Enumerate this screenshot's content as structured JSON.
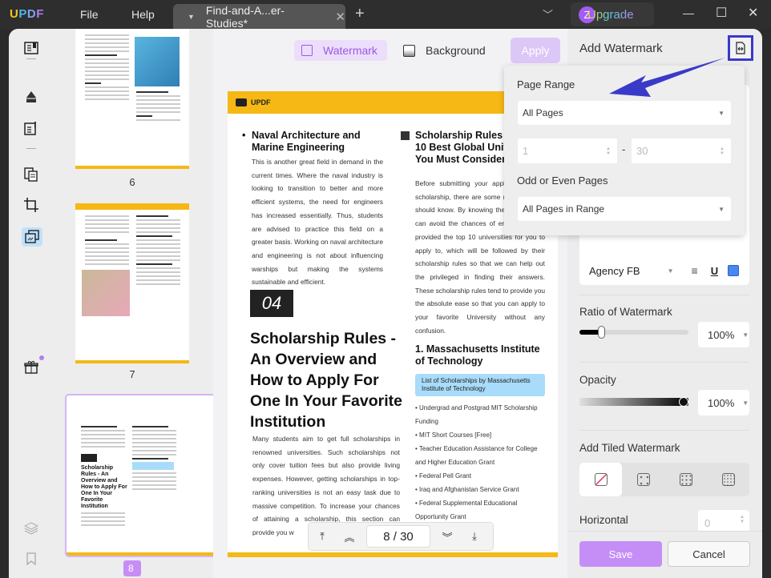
{
  "app": {
    "logo": [
      "U",
      "P",
      "D",
      "F"
    ],
    "menu": [
      "File",
      "Help"
    ]
  },
  "tab": {
    "title": "Find-and-A...er-Studies*",
    "close": "✕",
    "new_tab": "+"
  },
  "account": {
    "avatar_letter": "Z",
    "upgrade_label": "Upgrade"
  },
  "window": {
    "minimize": "—",
    "maximize": "☐",
    "close": "✕",
    "tab_list": "⌄"
  },
  "toolbar": {
    "watermark_label": "Watermark",
    "background_label": "Background",
    "apply_label": "Apply"
  },
  "thumbnails": [
    {
      "page": "6",
      "selected": false
    },
    {
      "page": "7",
      "selected": false
    },
    {
      "page": "8",
      "selected": true
    }
  ],
  "document": {
    "header_brand": "UPDF",
    "col1_heading": "Naval Architecture and Marine Engineering",
    "col1_body": "This is another great field in demand in the current times. Where the naval industry is looking to transition to better and more efficient systems, the need for engineers has increased essentially. Thus, students are advised to practice this field on a greater basis. Working on naval architecture and engineering is not about influencing warships but making the systems sustainable and efficient.",
    "section_number": "04",
    "section_title": "Scholarship Rules - An Overview and How to Apply For One In Your Favorite Institution",
    "section_body": "Many students aim to get full scholarships in renowned universities. Such scholarships not only cover tuition fees but also provide living expenses. However, getting scholarships in top-ranking universities is not an easy task due to massive competition. To increase your chances of attaining a scholarship, this section can provide you w",
    "col2_heading": "Scholarship Rules for the 10 Best Global Universities You Must Consider",
    "col2_body": "Before submitting your application for a scholarship, there are some rules that you should know. By knowing these rules, you can avoid the chances of error. We have provided the top 10 universities for you to apply to, which will be followed by their scholarship rules so that we can help out the privileged in finding their answers. These scholarship rules tend to provide you the absolute ease so that you can apply to your favorite University without any confusion.",
    "mit_heading": "1. Massachusetts Institute of Technology",
    "mit_box": "List of Scholarships by Massachusetts Institute of Technology",
    "mit_list": [
      "Undergrad and Postgrad MIT Scholarship Funding",
      "MIT Short Courses [Free]",
      "Teacher Education Assistance for College and Higher Education Grant",
      "Federal Pell Grant",
      "Iraq and Afghanistan Service Grant",
      "Federal Supplemental Educational Opportunity Grant"
    ]
  },
  "pagenav": {
    "current": "8",
    "separator": "/",
    "total": "30"
  },
  "panel": {
    "title": "Add Watermark",
    "font_name": "Agency FB",
    "font_color": "#4a86f0",
    "ratio_label": "Ratio of Watermark",
    "ratio_value": "100%",
    "ratio_slider_fraction": 0.2,
    "opacity_label": "Opacity",
    "opacity_value": "100%",
    "opacity_slider_fraction": 1.0,
    "tiled_label": "Add Tiled Watermark",
    "horizontal_label": "Horizontal",
    "horizontal_value": "0",
    "save_label": "Save",
    "cancel_label": "Cancel"
  },
  "popup": {
    "page_range_label": "Page Range",
    "page_range_value": "All Pages",
    "from_page": "1",
    "range_dash": "-",
    "to_page": "30",
    "odd_even_label": "Odd or Even Pages",
    "odd_even_value": "All Pages in Range"
  },
  "annotation": {
    "arrow_color": "#3a3ac8"
  }
}
